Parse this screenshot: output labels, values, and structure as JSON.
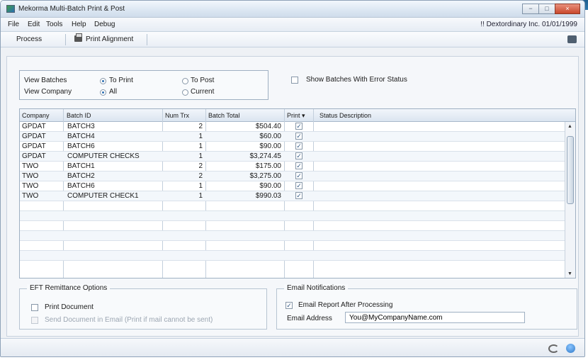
{
  "window": {
    "title": "Mekorma Multi-Batch Print & Post",
    "controls": [
      "−",
      "□",
      "×"
    ]
  },
  "menu": {
    "items": [
      "File",
      "Edit",
      "Tools",
      "Help",
      "Debug"
    ],
    "company": "Dextordinary Inc.  01/01/1999",
    "company_marker": "!!"
  },
  "toolbar": {
    "process_label": "Process",
    "print_alignment_label": "Print Alignment"
  },
  "filters": {
    "view_batches_label": "View Batches",
    "to_print_label": "To Print",
    "to_post_label": "To Post",
    "view_company_label": "View Company",
    "all_label": "All",
    "current_label": "Current",
    "show_errors_label": "Show Batches With Error Status",
    "selected_batches": "To Print",
    "selected_company": "All",
    "show_errors_checked": false
  },
  "grid": {
    "columns": [
      "Company",
      "Batch ID",
      "Num Trx",
      "Batch Total",
      "Print",
      "Status Description"
    ],
    "rows": [
      {
        "company": "GPDAT",
        "batch_id": "BATCH3",
        "num_trx": "2",
        "total": "$504.40",
        "print": "✓",
        "status": ""
      },
      {
        "company": "GPDAT",
        "batch_id": "BATCH4",
        "num_trx": "1",
        "total": "$60.00",
        "print": "✓",
        "status": ""
      },
      {
        "company": "GPDAT",
        "batch_id": "BATCH6",
        "num_trx": "1",
        "total": "$90.00",
        "print": "✓",
        "status": ""
      },
      {
        "company": "GPDAT",
        "batch_id": "COMPUTER CHECKS",
        "num_trx": "1",
        "total": "$3,274.45",
        "print": "✓",
        "status": ""
      },
      {
        "company": "TWO",
        "batch_id": "BATCH1",
        "num_trx": "2",
        "total": "$175.00",
        "print": "✓",
        "status": ""
      },
      {
        "company": "TWO",
        "batch_id": "BATCH2",
        "num_trx": "2",
        "total": "$3,275.00",
        "print": "✓",
        "status": ""
      },
      {
        "company": "TWO",
        "batch_id": "BATCH6",
        "num_trx": "1",
        "total": "$90.00",
        "print": "✓",
        "status": ""
      },
      {
        "company": "TWO",
        "batch_id": "COMPUTER CHECK1",
        "num_trx": "1",
        "total": "$990.03",
        "print": "✓",
        "status": ""
      }
    ],
    "empty_rows": 6,
    "print_header_marker": "▾"
  },
  "eft": {
    "title": "EFT Remittance Options",
    "print_document_label": "Print Document",
    "send_email_label": "Send Document in Email (Print if mail cannot be sent)",
    "print_document_checked": false,
    "send_email_checked": false
  },
  "email": {
    "title": "Email Notifications",
    "report_label": "Email Report After Processing",
    "report_checked": true,
    "address_label": "Email Address",
    "address_value": "You@MyCompanyName.com"
  },
  "icons": {
    "app": "app-icon",
    "printer": "printer-icon",
    "print_setup": "print-setup-icon",
    "refresh": "refresh-icon",
    "help": "help-icon"
  }
}
